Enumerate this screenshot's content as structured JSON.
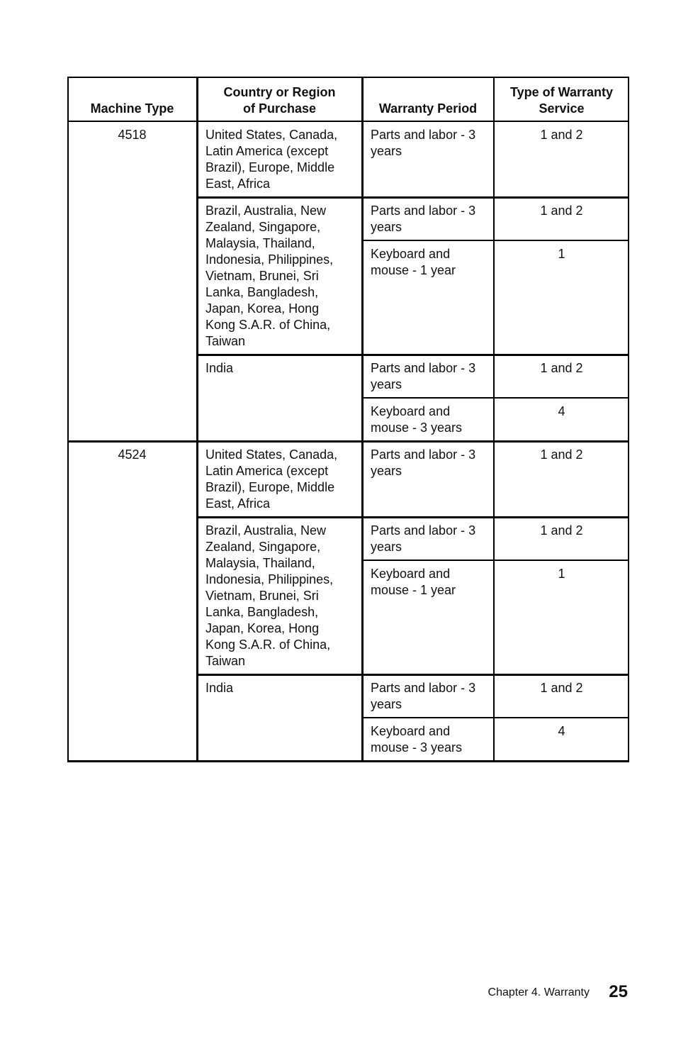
{
  "table": {
    "headers": {
      "machine_type": "Machine Type",
      "country_line1": "Country or Region",
      "country_line2": "of Purchase",
      "warranty_period": "Warranty Period",
      "service_line1": "Type of Warranty",
      "service_line2": "Service"
    },
    "machines": [
      {
        "type": "4518",
        "regions": [
          {
            "lines": [
              "United States, Canada,",
              "Latin America (except",
              "Brazil), Europe, Middle",
              "East, Africa"
            ],
            "entries": [
              {
                "period": [
                  "Parts and labor - 3",
                  "years"
                ],
                "service": "1 and 2"
              }
            ]
          },
          {
            "lines": [
              "Brazil, Australia, New",
              "Zealand, Singapore,",
              "Malaysia, Thailand,",
              "Indonesia, Philippines,",
              "Vietnam, Brunei, Sri",
              "Lanka, Bangladesh,",
              "Japan, Korea, Hong",
              "Kong S.A.R. of China,",
              "Taiwan"
            ],
            "entries": [
              {
                "period": [
                  "Parts and labor - 3",
                  "years"
                ],
                "service": "1 and 2"
              },
              {
                "period": [
                  "Keyboard and",
                  "mouse - 1 year"
                ],
                "service": "1"
              }
            ]
          },
          {
            "lines": [
              "India"
            ],
            "entries": [
              {
                "period": [
                  "Parts and labor - 3",
                  "years"
                ],
                "service": "1 and 2"
              },
              {
                "period": [
                  "Keyboard and",
                  "mouse - 3 years"
                ],
                "service": "4"
              }
            ]
          }
        ]
      },
      {
        "type": "4524",
        "regions": [
          {
            "lines": [
              "United States, Canada,",
              "Latin America (except",
              "Brazil), Europe, Middle",
              "East, Africa"
            ],
            "entries": [
              {
                "period": [
                  "Parts and labor - 3",
                  "years"
                ],
                "service": "1 and 2"
              }
            ]
          },
          {
            "lines": [
              "Brazil, Australia, New",
              "Zealand, Singapore,",
              "Malaysia, Thailand,",
              "Indonesia, Philippines,",
              "Vietnam, Brunei, Sri",
              "Lanka, Bangladesh,",
              "Japan, Korea, Hong",
              "Kong S.A.R. of China,",
              "Taiwan"
            ],
            "entries": [
              {
                "period": [
                  "Parts and labor - 3",
                  "years"
                ],
                "service": "1 and 2"
              },
              {
                "period": [
                  "Keyboard and",
                  "mouse - 1 year"
                ],
                "service": "1"
              }
            ]
          },
          {
            "lines": [
              "India"
            ],
            "entries": [
              {
                "period": [
                  "Parts and labor - 3",
                  "years"
                ],
                "service": "1 and 2"
              },
              {
                "period": [
                  "Keyboard and",
                  "mouse - 3 years"
                ],
                "service": "4"
              }
            ]
          }
        ]
      }
    ]
  },
  "footer": {
    "chapter": "Chapter 4.  Warranty",
    "page_number": "25"
  }
}
